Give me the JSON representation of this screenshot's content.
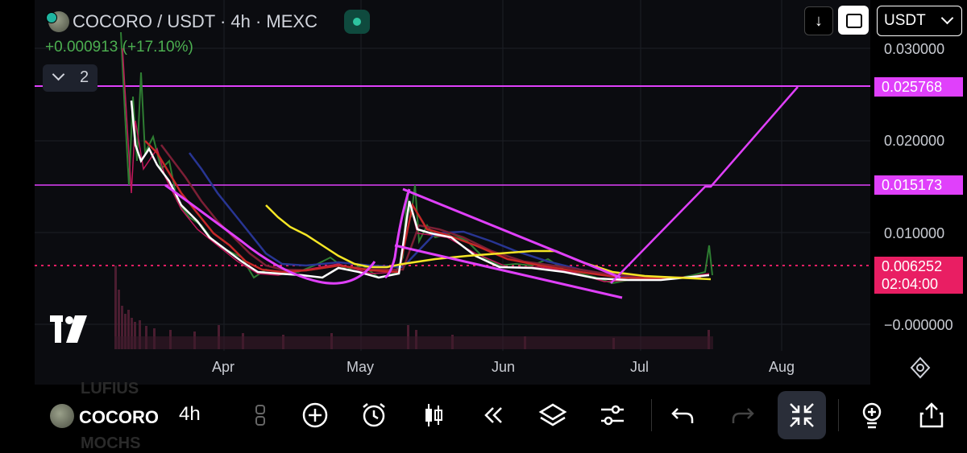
{
  "header": {
    "title": "COCORO / USDT · 4h · MEXC",
    "change": "+0.000913 (+17.10%)",
    "indicators_count": "2",
    "currency": "USDT"
  },
  "price_axis": {
    "ticks": [
      "0.030000",
      "0.020000",
      "0.010000",
      "−0.000000"
    ],
    "tags": {
      "level_high": "0.025768",
      "level_mid": "0.015173",
      "current_price": "0.006252",
      "countdown": "02:04:00"
    }
  },
  "time_axis": {
    "labels": [
      "Apr",
      "May",
      "Jun",
      "Jul",
      "Aug"
    ]
  },
  "toolbar": {
    "symbol": "COCORO",
    "interval": "4h",
    "ghost_above": "LUFIUS",
    "ghost_below": "MOCHS"
  },
  "icons": {
    "coin": "coin-icon",
    "status": "market-status-dot",
    "down": "arrow-down-icon",
    "swap": "swap-icon",
    "settings": "settings-icon",
    "add": "plus-circle-icon",
    "alert": "alarm-icon",
    "candles": "candles-icon",
    "replay": "rewind-icon",
    "layers": "layers-icon",
    "adjust": "sliders-icon",
    "undo": "undo-icon",
    "redo": "redo-icon",
    "fullscreen": "collapse-icon",
    "idea": "lightbulb-icon",
    "share": "share-icon"
  },
  "colors": {
    "drawing": "#e040fb",
    "current_price": "#e91e63",
    "ma_yellow": "#f5e625",
    "ma_white": "#ffffff",
    "ma_red": "#c62828",
    "ma_blue": "#1a237e",
    "up": "#4caf50",
    "down": "#c2185b"
  }
}
